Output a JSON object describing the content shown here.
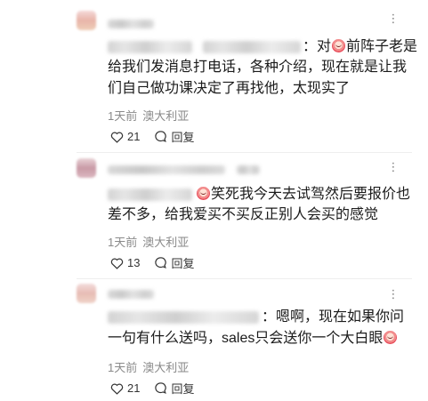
{
  "icons": {
    "more": "more-dots-icon",
    "like": "heart-outline-icon",
    "reply": "speech-bubble-icon",
    "emoji": "crying-laughing-emoji-icon"
  },
  "colors": {
    "meta_gray": "#8a8a8a",
    "divider": "#eeeeee"
  },
  "comments": [
    {
      "lines": [
        "：对",
        "前阵子老是",
        "给我们发消息打电话，各种介绍，现在就是让我",
        "们自己做功课决定了再找他，太现实了"
      ],
      "time": "1天前",
      "location": "澳大利亚",
      "likes": "21",
      "reply_label": "回复"
    },
    {
      "lines": [
        "笑死我今天去试驾然后要报价也",
        "差不多，给我爱买不买反正别人会买的感觉"
      ],
      "time": "1天前",
      "location": "澳大利亚",
      "likes": "13",
      "reply_label": "回复"
    },
    {
      "lines": [
        "：嗯啊，现在如果你问",
        "一句有什么送吗，sales只会送你一个大白眼"
      ],
      "time": "1天前",
      "location": "澳大利亚",
      "likes": "21",
      "reply_label": "回复"
    }
  ]
}
